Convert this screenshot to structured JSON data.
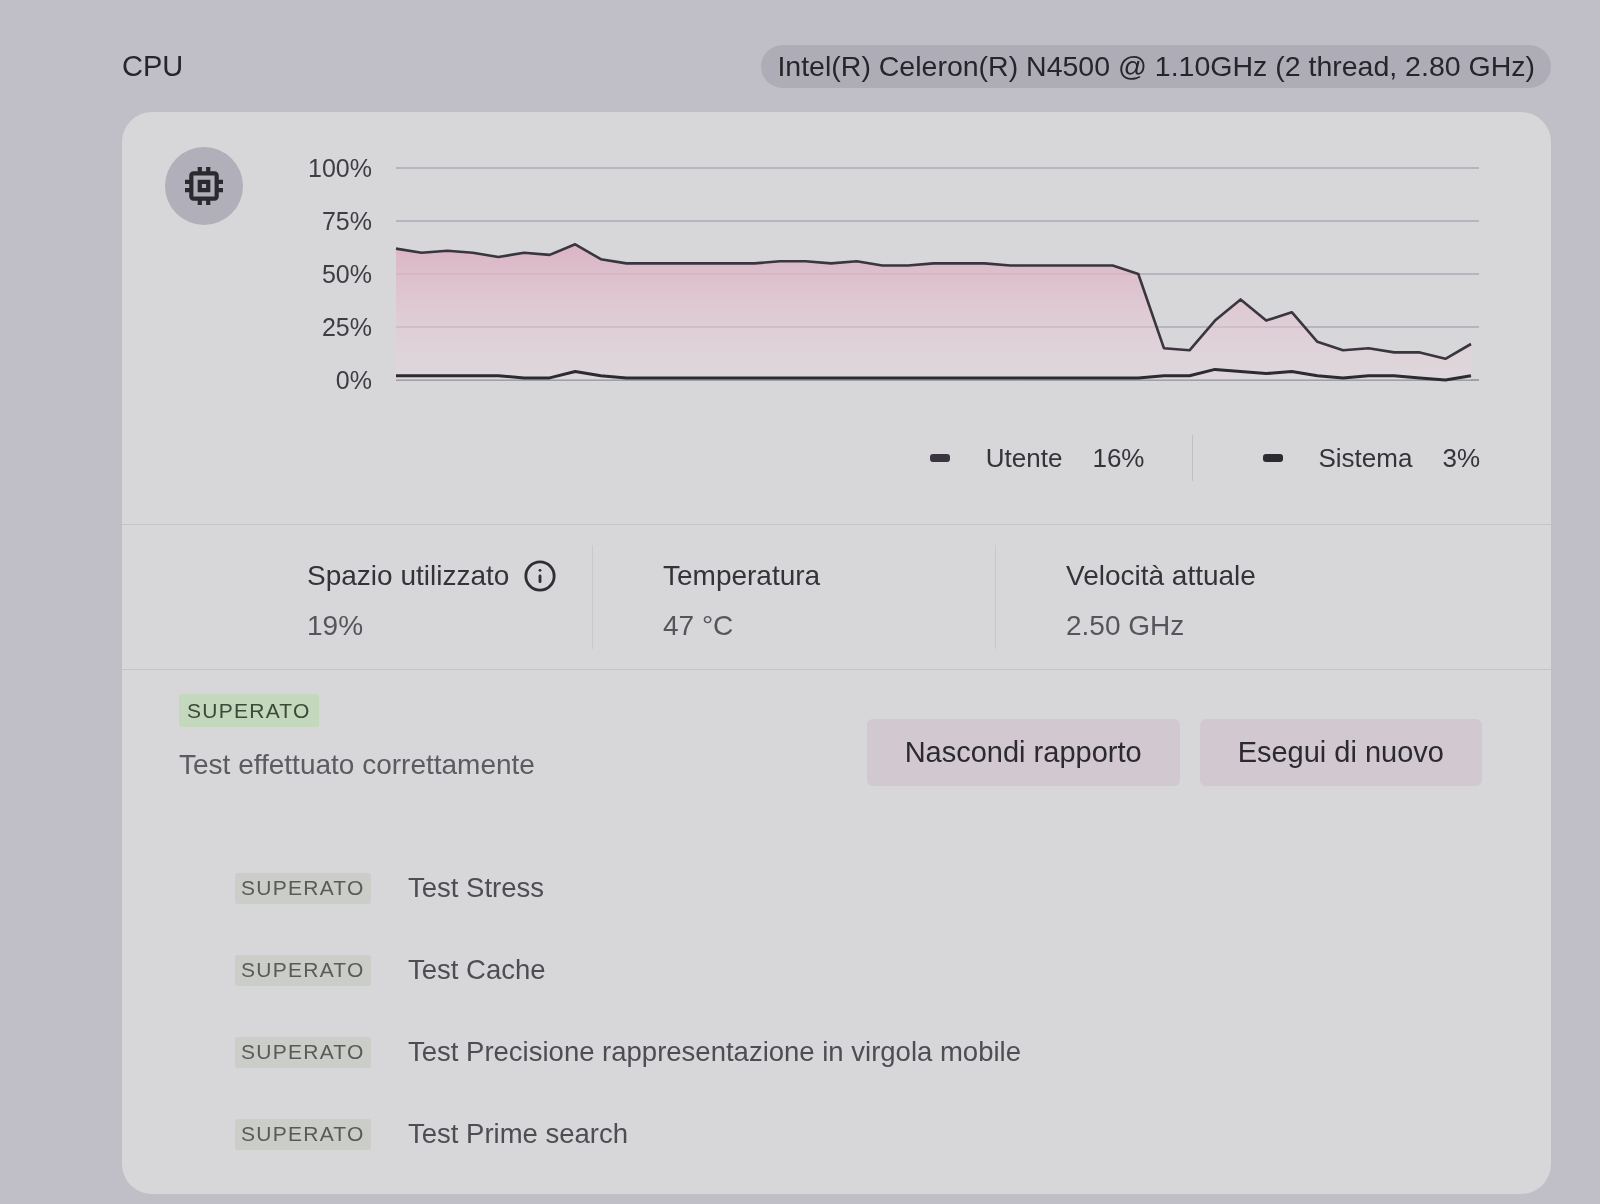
{
  "header": {
    "title": "CPU",
    "processor": "Intel(R) Celeron(R) N4500 @ 1.10GHz (2 thread, 2.80 GHz)"
  },
  "usage_card": {
    "chart_data": [
      {
        "type": "line",
        "categories": [
          null,
          null,
          null,
          null,
          null,
          null,
          null,
          null,
          null,
          null,
          null,
          null,
          null,
          null,
          null,
          null,
          null,
          null,
          null,
          null,
          null,
          null,
          null,
          null,
          null,
          null,
          null,
          null,
          null,
          null,
          null,
          null,
          null,
          null,
          null,
          null,
          null,
          null,
          null,
          null,
          null,
          null,
          null
        ],
        "ylim": [
          0,
          100
        ],
        "yticks": [
          {
            "value": 0,
            "label": "0%"
          },
          {
            "value": 25,
            "label": "25%"
          },
          {
            "value": 50,
            "label": "50%"
          },
          {
            "value": 75,
            "label": "75%"
          },
          {
            "value": 100,
            "label": "100%"
          }
        ],
        "tick_labels": "y",
        "grid": true,
        "legend": "bottom",
        "series": [
          {
            "name": "Utente",
            "type": "area",
            "color": "#3a353e",
            "values": [
              62,
              60,
              61,
              60,
              58,
              60,
              59,
              64,
              57,
              55,
              55,
              55,
              55,
              55,
              55,
              56,
              56,
              55,
              56,
              54,
              54,
              55,
              55,
              55,
              54,
              54,
              54,
              54,
              54,
              50,
              15,
              14,
              28,
              38,
              28,
              32,
              18,
              14,
              15,
              13,
              13,
              10,
              17
            ]
          },
          {
            "name": "Sistema",
            "type": "line",
            "color": "#2c2c30",
            "values": [
              2,
              2,
              2,
              2,
              2,
              1,
              1,
              4,
              2,
              1,
              1,
              1,
              1,
              1,
              1,
              1,
              1,
              1,
              1,
              1,
              1,
              1,
              1,
              1,
              1,
              1,
              1,
              1,
              1,
              1,
              2,
              2,
              5,
              4,
              3,
              4,
              2,
              1,
              2,
              2,
              1,
              0,
              2
            ]
          }
        ]
      }
    ],
    "legend": [
      {
        "value": "16%"
      },
      {
        "value": "3%"
      }
    ]
  },
  "stats": [
    {
      "kind": "info",
      "label": "Spazio utilizzato",
      "value": "19%"
    },
    {
      "kind": "plain",
      "label": "Temperatura",
      "value": "47 °C"
    },
    {
      "kind": "plain",
      "label": "Velocità attuale",
      "value": "2.50 GHz"
    }
  ],
  "summary": {
    "badge": "SUPERATO",
    "message": "Test effettuato correttamente"
  },
  "buttons": [
    "Nascondi rapporto",
    "Esegui di nuovo"
  ],
  "routines": [
    {
      "badge": "SUPERATO",
      "name": "Test Stress"
    },
    {
      "badge": "SUPERATO",
      "name": "Test Cache"
    },
    {
      "badge": "SUPERATO",
      "name": "Test Precisione rappresentazione in virgola mobile"
    },
    {
      "badge": "SUPERATO",
      "name": "Test Prime search"
    }
  ]
}
